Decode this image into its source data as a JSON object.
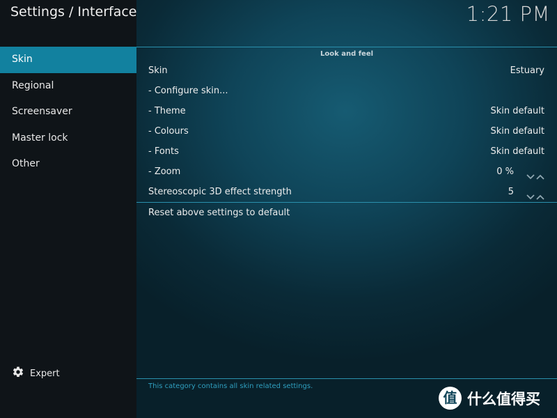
{
  "header": {
    "title": "Settings / Interface",
    "clock": "1:21 PM"
  },
  "sidebar": {
    "items": [
      {
        "label": "Skin",
        "active": true
      },
      {
        "label": "Regional",
        "active": false
      },
      {
        "label": "Screensaver",
        "active": false
      },
      {
        "label": "Master lock",
        "active": false
      },
      {
        "label": "Other",
        "active": false
      }
    ],
    "expert_label": "Expert",
    "expert_icon": "gear-icon"
  },
  "main": {
    "section_header": "Look and feel",
    "settings": [
      {
        "label": "Skin",
        "value": "Estuary"
      },
      {
        "label": "- Configure skin...",
        "value": ""
      },
      {
        "label": "- Theme",
        "value": "Skin default"
      },
      {
        "label": "- Colours",
        "value": "Skin default"
      },
      {
        "label": "- Fonts",
        "value": "Skin default"
      },
      {
        "label": "- Zoom",
        "value": "0 %"
      },
      {
        "label": "Stereoscopic 3D effect strength",
        "value": "5"
      }
    ],
    "reset_label": "Reset above settings to default"
  },
  "footer": {
    "description": "This category contains all skin related settings."
  },
  "watermark": {
    "logo_char": "值",
    "text": "什么值得买"
  },
  "colors": {
    "accent": "#12819f",
    "divider": "#2a90ad",
    "footer_text": "#2f9fbf",
    "sidebar_bg": "#0f1418"
  }
}
